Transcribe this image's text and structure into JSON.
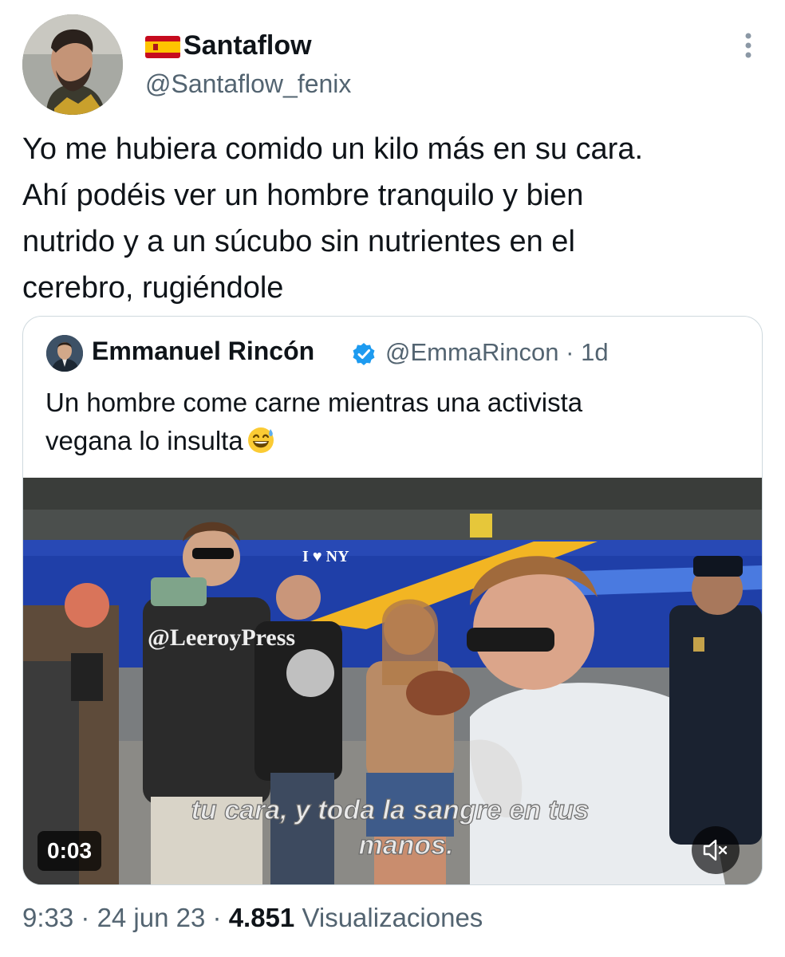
{
  "author": {
    "display_name": "Santaflow",
    "handle": "@Santaflow_fenix",
    "flag_icon": "spain-flag-icon"
  },
  "tweet": {
    "lines": [
      "Yo me hubiera comido un kilo más en su cara.",
      "Ahí podéis ver un hombre tranquilo y bien",
      "nutrido y a un súcubo sin nutrientes en el",
      "cerebro, rugiéndole"
    ]
  },
  "quote": {
    "display_name": "Emmanuel Rincón",
    "verified_icon": "verified-badge-icon",
    "verified_color": "#1d9bf0",
    "handle": "@EmmaRincon",
    "separator": "·",
    "age": "1d",
    "lines": [
      "Un hombre come carne mientras una activista",
      "vegana lo insulta"
    ],
    "emoji_icon": "grinning-sweat-emoji-icon"
  },
  "video": {
    "duration": "0:03",
    "watermark": "@LeeroyPress",
    "caption_line1": "tu cara, y toda la sangre en tus",
    "caption_line2": "manos.",
    "bus_text": "I ♥ NY",
    "mute_icon": "speaker-muted-icon"
  },
  "meta": {
    "time": "9:33",
    "sep1": " · ",
    "date": "24 jun 23",
    "sep2": " · ",
    "views": "4.851",
    "views_label": " Visualizaciones"
  }
}
